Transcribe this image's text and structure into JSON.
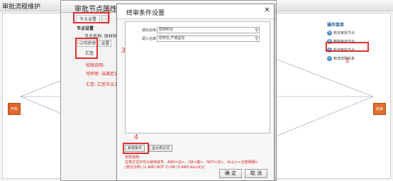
{
  "base_window": {
    "title": "审批流程维护",
    "start_node": "开始",
    "end_node": "结束",
    "ops_panel": {
      "header": "操作菜单",
      "items": [
        {
          "label": "修改审批节点",
          "icon": "edit-icon"
        },
        {
          "label": "删除审批节点",
          "icon": "delete-icon"
        },
        {
          "label": "新增审批节点",
          "icon": "add-icon"
        },
        {
          "label": "新增流程关系",
          "icon": "link-icon"
        }
      ]
    }
  },
  "props_dialog": {
    "title": "审批节点属性设置",
    "tabs": [
      "节点设置",
      "·"
    ],
    "section_label": "节点设置",
    "node_name": "节点名称: 原材料仓",
    "checks": [
      "☑可终审",
      "设置"
    ],
    "summary": "汇签",
    "desc_head": "权限说明:",
    "desc_lines": [
      "可终审:  当满足设置",
      "汇签:  汇签节点上"
    ],
    "right_tab": "设"
  },
  "cond_dialog": {
    "title": "终审条件设置",
    "close_label": "✕",
    "rows": [
      {
        "label": "调出仓库",
        "value": "原材料仓"
      },
      {
        "label": "调入仓库",
        "value": "原材仓,产成品仓"
      }
    ],
    "buttons": [
      "新增条件",
      "显示表达式"
    ],
    "help_lines": [
      "权限说明:",
      "  在表达式中可以使用括号、AND=且>、OR<或>、NOT<非>、ALL(><全部明细>",
      "[表达示例: (1 AND NOT 2) OR (3 AND ALL(4))]"
    ],
    "confirm_label": "确 定",
    "cancel_label": "取 消"
  },
  "steps": [
    "1",
    "2",
    "3",
    "4"
  ],
  "colors": {
    "highlight": "#e03030",
    "node": "#e0662a",
    "hint_text": "#d92020"
  }
}
